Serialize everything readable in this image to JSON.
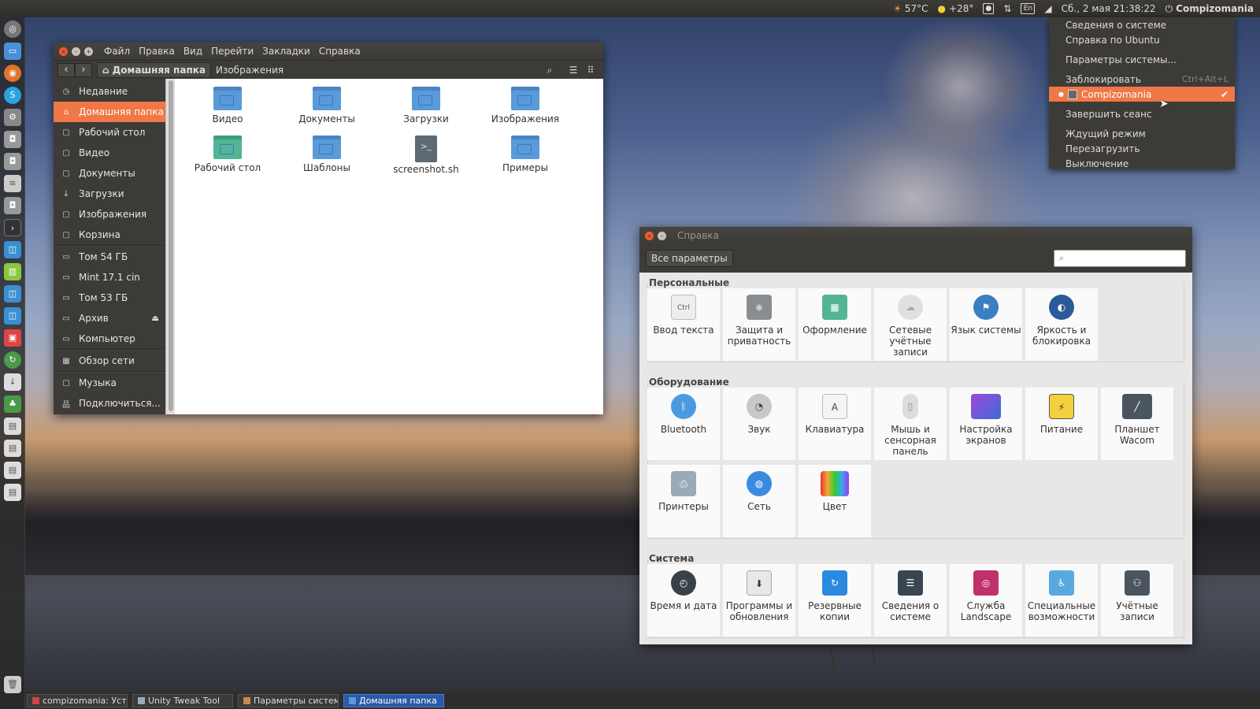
{
  "top_panel": {
    "temp_cpu": "57°C",
    "weather": "+28°",
    "lang": "En",
    "datetime": "Сб., 2 мая 21:38:22",
    "user": "Compizomania"
  },
  "sys_menu": {
    "items": [
      {
        "label": "Сведения о системе",
        "accel": ""
      },
      {
        "label": "Справка по Ubuntu",
        "accel": ""
      },
      {
        "label": "Параметры системы...",
        "accel": ""
      },
      {
        "label": "Заблокировать",
        "accel": "Ctrl+Alt+L"
      },
      {
        "label": "Compizomania",
        "accel": ""
      },
      {
        "label": "Завершить сеанс",
        "accel": ""
      },
      {
        "label": "Ждущий режим",
        "accel": ""
      },
      {
        "label": "Перезагрузить",
        "accel": ""
      },
      {
        "label": "Выключение",
        "accel": ""
      }
    ]
  },
  "file_manager": {
    "menu": [
      "Файл",
      "Правка",
      "Вид",
      "Перейти",
      "Закладки",
      "Справка"
    ],
    "breadcrumb": [
      "Домашняя папка",
      "Изображения"
    ],
    "sidebar": [
      "Недавние",
      "Домашняя папка",
      "Рабочий стол",
      "Видео",
      "Документы",
      "Загрузки",
      "Изображения",
      "Корзина",
      "Том 54 ГБ",
      "Mint 17.1 cin",
      "Том 53 ГБ",
      "Архив",
      "Компьютер",
      "Обзор сети",
      "Музыка",
      "Подключиться..."
    ],
    "files": [
      "Видео",
      "Документы",
      "Загрузки",
      "Изображения",
      "Рабочий стол",
      "Шаблоны",
      "screenshot.sh",
      "Примеры"
    ]
  },
  "settings": {
    "title": "Справка",
    "all_button": "Все параметры",
    "categories": [
      {
        "title": "Персональные",
        "items": [
          "Ввод текста",
          "Защита и приватность",
          "Оформление",
          "Сетевые учётные записи",
          "Язык системы",
          "Яркость и блокировка"
        ]
      },
      {
        "title": "Оборудование",
        "items": [
          "Bluetooth",
          "Звук",
          "Клавиатура",
          "Мышь и сенсорная панель",
          "Настройка экранов",
          "Питание",
          "Планшет Wacom",
          "Принтеры",
          "Сеть",
          "Цвет"
        ]
      },
      {
        "title": "Система",
        "items": [
          "Время и дата",
          "Программы и обновления",
          "Резервные копии",
          "Сведения о системе",
          "Служба Landscape",
          "Специальные возможности",
          "Учётные записи"
        ]
      }
    ]
  },
  "taskbar": [
    "compizomania: Уст...",
    "Unity Tweak Tool",
    "Параметры системы",
    "Домашняя папка"
  ]
}
